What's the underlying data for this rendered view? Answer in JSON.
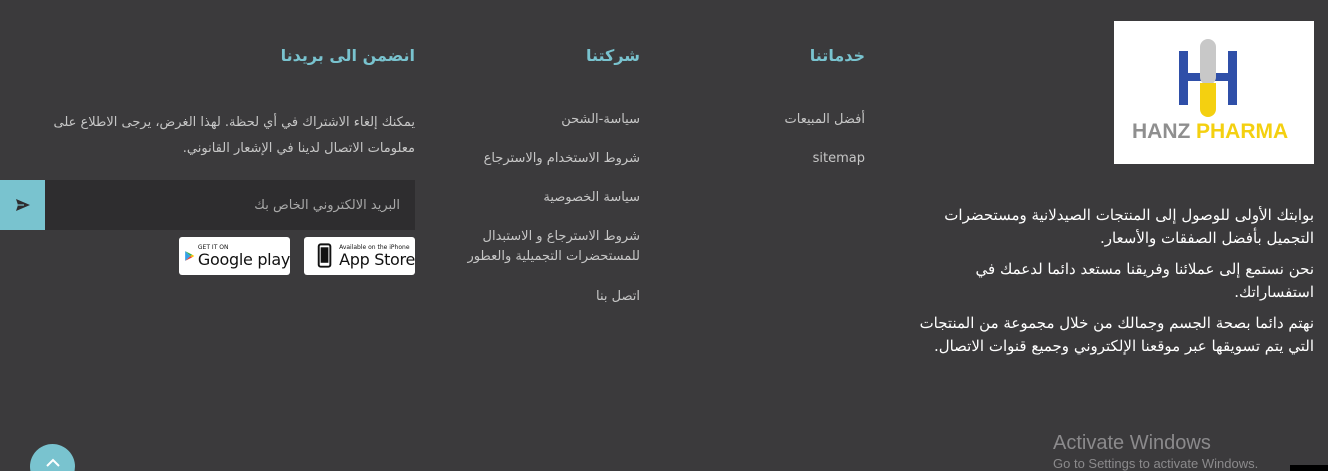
{
  "brand": {
    "logo_text_primary": "HANZ",
    "logo_text_secondary": "PHARMA",
    "colors": {
      "accent": "#79c3cf",
      "logo_blue": "#2f4fa8",
      "logo_yellow": "#f4d010",
      "logo_grey": "#c8c8c8",
      "background": "#3b3a3c"
    }
  },
  "about": {
    "paragraphs": [
      "بوابتك الأولى للوصول إلى المنتجات الصيدلانية ومستحضرات التجميل بأفضل الصفقات والأسعار.",
      "نحن نستمع إلى عملائنا وفريقنا مستعد دائما لدعمك في استفساراتك.",
      "نهتم دائما بصحة الجسم وجمالك من خلال مجموعة من المنتجات التي يتم تسويقها عبر موقعنا الإلكتروني وجميع قنوات الاتصال."
    ]
  },
  "services": {
    "title": "خدماتنا",
    "links": [
      "أفضل المبيعات",
      "sitemap"
    ]
  },
  "company": {
    "title": "شركتنا",
    "links": [
      "سياسة-الشحن",
      "شروط الاستخدام والاسترجاع",
      "سياسة الخصوصية",
      "شروط الاسترجاع و الاستبدال للمستحضرات التجميلية والعطور",
      "اتصل بنا"
    ]
  },
  "newsletter": {
    "title": "انضمن الى بريدنا",
    "description": "يمكنك إلغاء الاشتراك في أي لحظة. لهذا الغرض، يرجى الاطلاع على معلومات الاتصال لدينا في الإشعار القانوني.",
    "email_placeholder": "البريد الالكتروني الخاص بك",
    "email_value": "",
    "send_icon": "send-icon"
  },
  "apps": {
    "appstore_small": "Available on the iPhone",
    "appstore_big": "App Store",
    "googleplay_small": "GET IT ON",
    "googleplay_big": "Google play"
  },
  "watermark": {
    "title": "Activate Windows",
    "subtitle": "Go to Settings to activate Windows."
  }
}
